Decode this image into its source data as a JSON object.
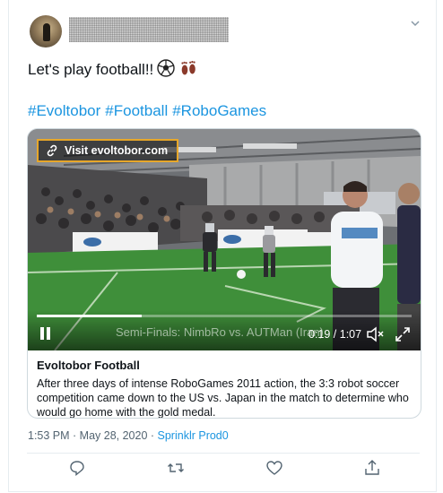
{
  "tweet": {
    "text": "Let's play football!!",
    "emojis": [
      "soccer-ball",
      "footprints"
    ],
    "hashtags": [
      "#Evoltobor",
      "#Football",
      "#RoboGames"
    ],
    "timestamp": "1:53 PM · May 28, 2020",
    "separator": " · ",
    "source": "Sprinklr Prod0"
  },
  "media": {
    "visit_label": "Visit evoltobor.com",
    "video_caption": "Semi-Finals: NimbRo vs. AUTMan (Iran)",
    "time_display": "0:19 / 1:07",
    "progress_fraction": 0.28,
    "card_title": "Evoltobor Football",
    "card_description": "After three days of intense RoboGames 2011 action, the 3:3 robot soccer competition came down to the US vs. Japan in the match to determine who would go home with the gold medal."
  },
  "colors": {
    "link": "#1b95e0",
    "visit_border": "#e7a72a",
    "pitch": "#3f8f3a"
  },
  "icons": [
    "chevron-down-icon",
    "link-icon",
    "pause-icon",
    "volume-muted-icon",
    "expand-icon",
    "reply-icon",
    "retweet-icon",
    "like-icon",
    "share-icon"
  ]
}
